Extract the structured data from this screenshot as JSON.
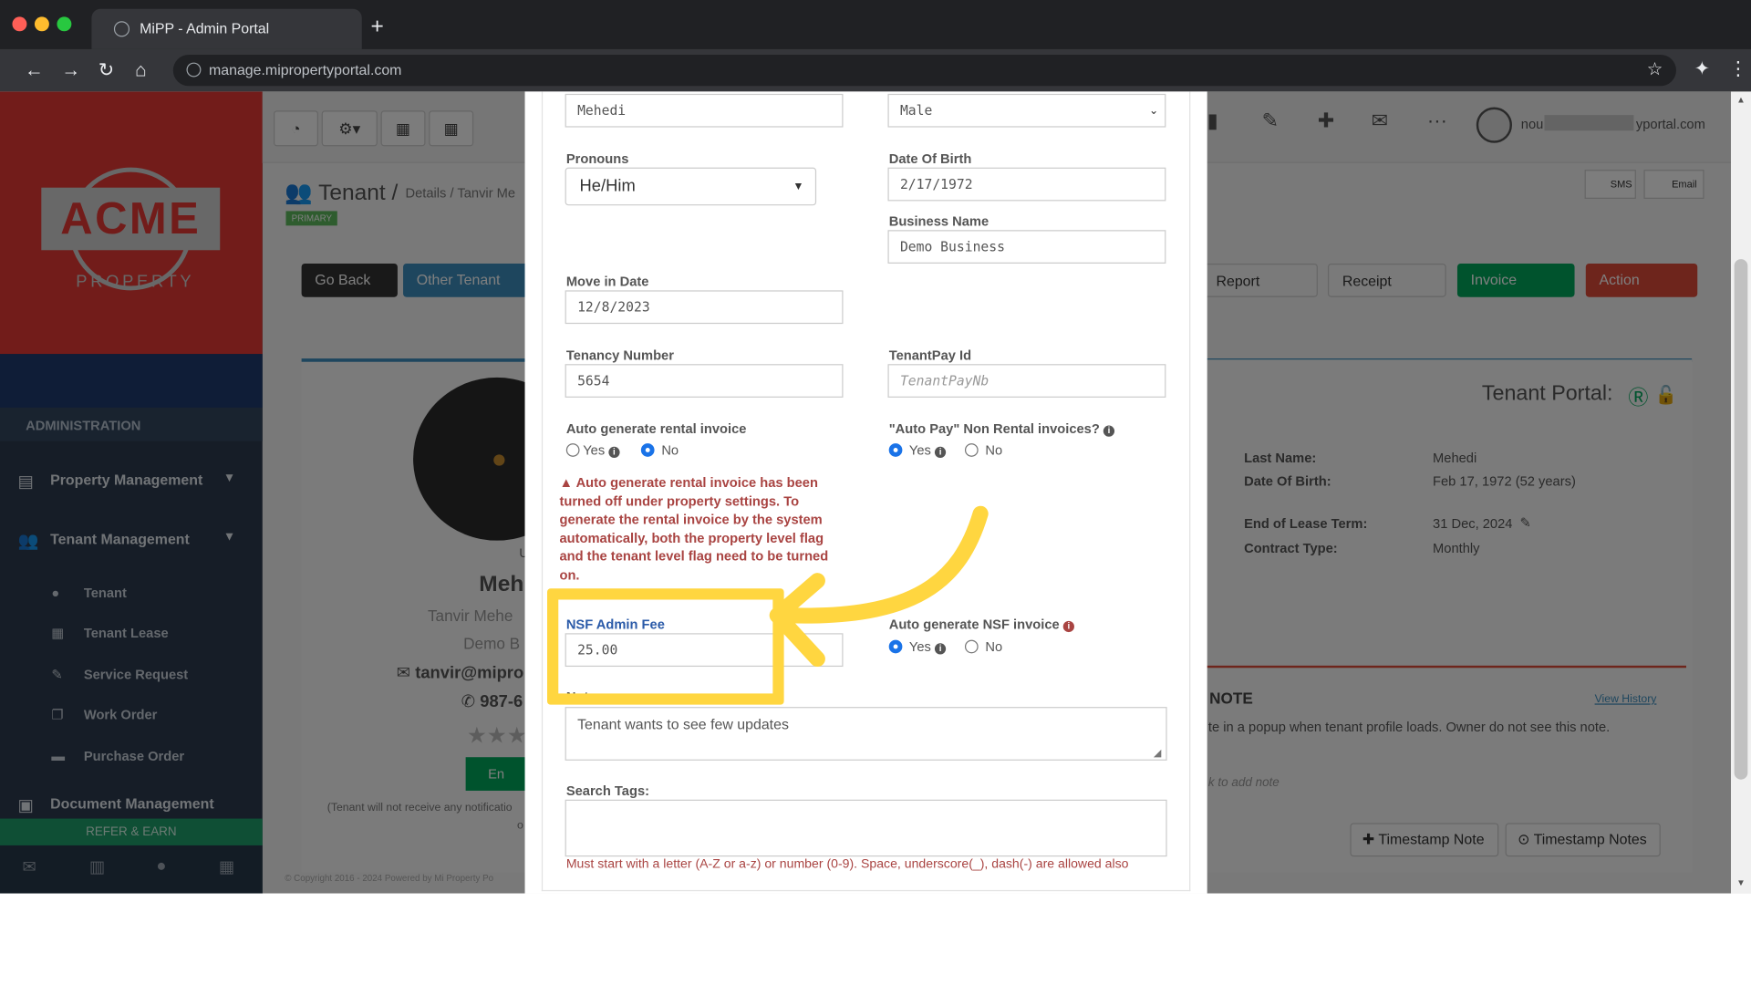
{
  "browser": {
    "tab_title": "MiPP - Admin Portal",
    "new_tab": "+",
    "url": "manage.mipropertyportal.com",
    "back": "←",
    "forward": "→",
    "reload": "↻",
    "home": "⌂",
    "bookmark": "☆",
    "extensions": "✦",
    "menu": "⋮"
  },
  "logo": {
    "name": "ACME",
    "tagline": "PROPERTY"
  },
  "sidebar": {
    "section_label": "ADMINISTRATION",
    "items": [
      {
        "label": "Property Management",
        "icon": "building-icon"
      },
      {
        "label": "Tenant Management",
        "icon": "users-icon"
      }
    ],
    "subitems": [
      {
        "label": "Tenant"
      },
      {
        "label": "Tenant Lease"
      },
      {
        "label": "Service Request"
      },
      {
        "label": "Work Order"
      },
      {
        "label": "Purchase Order"
      }
    ],
    "document_management": "Document Management",
    "refer": "REFER & EARN"
  },
  "header": {
    "user_email_start": "nou",
    "user_email_end": "yportal.com",
    "sms": "SMS",
    "email": "Email"
  },
  "page": {
    "title": "Tenant",
    "separator": "/",
    "breadcrumb": "Details / Tanvir Me",
    "badge": "PRIMARY",
    "go_back": "Go Back",
    "other_tenant": "Other Tenant",
    "report": "Report",
    "receipt": "Receipt",
    "invoice": "Invoice",
    "action": "Action",
    "profile_initial": "U",
    "profile_name": "Meh",
    "profile_full": "Tanvir Mehe",
    "profile_company": "Demo B",
    "profile_email": "tanvir@mipro",
    "profile_phone": "987-6",
    "enable_btn": "En",
    "notice": "(Tenant will not receive any notificatio",
    "notice_2": "o",
    "tenant_portal": "Tenant Portal:",
    "last_name_label": "Last Name:",
    "last_name": "Mehedi",
    "dob_label": "Date Of Birth:",
    "dob": "Feb 17, 1972 (52 years)",
    "lease_label": "End of Lease Term:",
    "lease": "31 Dec, 2024",
    "contract_label": "Contract Type:",
    "contract": "Monthly",
    "note_title": "NOTE",
    "view_history": "View History",
    "note_text": "te in a popup when tenant profile loads. Owner do not see this note.",
    "note_add": "k to add note",
    "timestamp_note": "Timestamp Note",
    "timestamp_notes": "Timestamp Notes",
    "copyright": "© Copyright 2016 - 2024 Powered by Mi Property Po"
  },
  "modal": {
    "last_name_value": "Mehedi",
    "gender_value": "Male",
    "pronouns_label": "Pronouns",
    "pronouns_value": "He/Him",
    "dob_label": "Date Of Birth",
    "dob_value": "2/17/1972",
    "business_label": "Business Name",
    "business_value": "Demo Business",
    "move_in_label": "Move in Date",
    "move_in_value": "12/8/2023",
    "tenancy_label": "Tenancy Number",
    "tenancy_value": "5654",
    "tenantpay_label": "TenantPay Id",
    "tenantpay_placeholder": "TenantPayNb",
    "auto_rent_label": "Auto generate rental invoice",
    "yes": "Yes",
    "no": "No",
    "auto_pay_label": "\"Auto Pay\" Non Rental invoices?",
    "warning": "Auto generate rental invoice has been turned off under property settings. To generate the rental invoice by the system automatically, both the property level flag and the tenant level flag need to be turned on.",
    "nsf_fee_label": "NSF Admin Fee",
    "nsf_fee_value": "25.00",
    "auto_nsf_label": "Auto generate NSF invoice",
    "note_label": "Note:",
    "note_value": "Tenant wants to see few updates",
    "tags_label": "Search Tags:",
    "tags_help": "Must start with a letter (A-Z or a-z) or number (0-9). Space, underscore(_), dash(-) are allowed also"
  },
  "colors": {
    "highlight": "#ffd640",
    "brand_red": "#e53935",
    "link_blue": "#3c8dbc"
  }
}
